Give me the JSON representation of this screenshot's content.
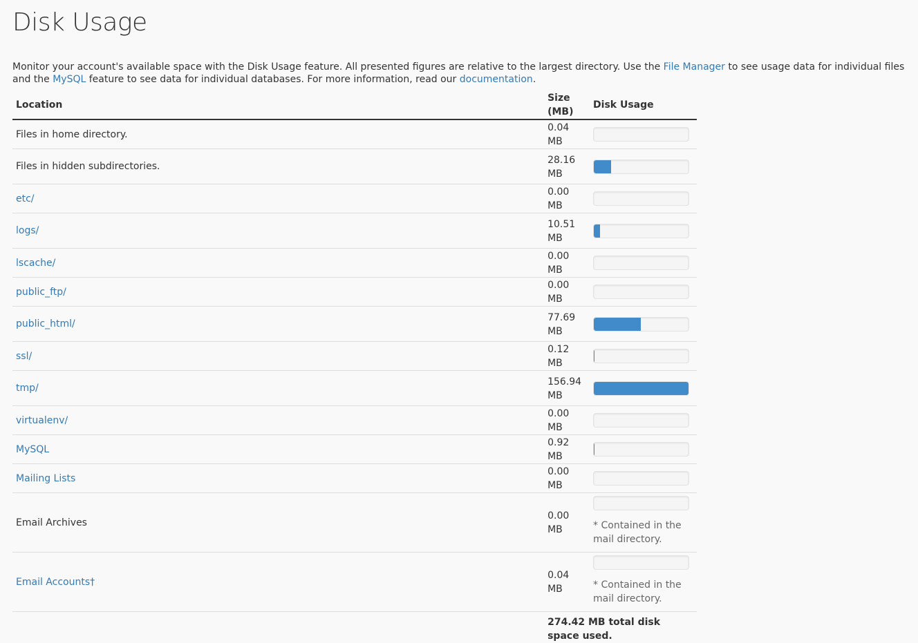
{
  "page": {
    "title": "Disk Usage",
    "intro": {
      "text1": "Monitor your account's available space with the Disk Usage feature. All presented figures are relative to the largest directory. Use the ",
      "link_file_manager": "File Manager",
      "text2": " to see usage data for individual files and the ",
      "link_mysql": "MySQL",
      "text3": " feature to see data for individual databases. For more information, read our ",
      "link_documentation": "documentation",
      "text4": "."
    }
  },
  "table": {
    "headers": {
      "location": "Location",
      "size": "Size (MB)",
      "usage": "Disk Usage"
    },
    "rows": [
      {
        "location": "Files in home directory.",
        "link": false,
        "size": "0.04 MB",
        "fraction": 0.0003
      },
      {
        "location": "Files in hidden subdirectories.",
        "link": false,
        "size": "28.16 MB",
        "fraction": 0.179
      },
      {
        "location": "etc/",
        "link": true,
        "size": "0.00 MB",
        "fraction": 0
      },
      {
        "location": "logs/",
        "link": true,
        "size": "10.51 MB",
        "fraction": 0.067
      },
      {
        "location": "lscache/",
        "link": true,
        "size": "0.00 MB",
        "fraction": 0
      },
      {
        "location": "public_ftp/",
        "link": true,
        "size": "0.00 MB",
        "fraction": 0
      },
      {
        "location": "public_html/",
        "link": true,
        "size": "77.69 MB",
        "fraction": 0.495
      },
      {
        "location": "ssl/",
        "link": true,
        "size": "0.12 MB",
        "fraction": 0.001
      },
      {
        "location": "tmp/",
        "link": true,
        "size": "156.94 MB",
        "fraction": 1.0
      },
      {
        "location": "virtualenv/",
        "link": true,
        "size": "0.00 MB",
        "fraction": 0
      },
      {
        "location": "MySQL",
        "link": true,
        "size": "0.92 MB",
        "fraction": 0.006
      },
      {
        "location": "Mailing Lists",
        "link": true,
        "size": "0.00 MB",
        "fraction": 0
      },
      {
        "location": "Email Archives",
        "link": false,
        "size": "0.00 MB",
        "fraction": 0,
        "note": "* Contained in the mail directory."
      },
      {
        "location": "Email Accounts†",
        "link": true,
        "size": "0.04 MB",
        "fraction": 0.0003,
        "note": "* Contained in the mail directory."
      }
    ],
    "total": "274.42 MB total disk space used."
  },
  "colors": {
    "link": "#337ab7",
    "bar_fill": "#428bca",
    "bar_track": "#f5f5f5"
  }
}
